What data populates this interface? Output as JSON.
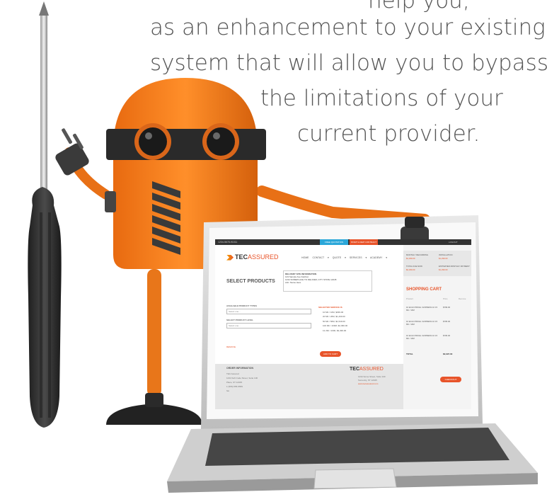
{
  "headline": [
    "help you,",
    "as an enhancement to your existing",
    "system that will allow you to bypass",
    "the limitations of your",
    "current provider."
  ],
  "colors": {
    "robot_orange": "#f07a1a",
    "screwdriver_handle": "#2d2d2d",
    "screen_accent": "#e8542a",
    "screen_blue": "#2ba7d9",
    "laptop_silver": "#d9d9d9"
  },
  "screen": {
    "topbar": {
      "phone": "1234-5678-91011",
      "quote_button": "FREE QUOTATION",
      "rep_button": "START A REP CONTRACT",
      "account": "LOGOUT"
    },
    "logo": {
      "part1": "TEC",
      "part2": "ASSURED"
    },
    "nav": "HOME  CONTACT ▾  QUOTE ▾  SERVICES ▾  ACADEMY ▾",
    "select_products": "SELECT PRODUCTS",
    "delivery": {
      "title": "DELIVERY SITE INFORMATION",
      "lines": [
        "123 Sample Ave Fashion",
        "1234 SOMEPLACE TO DELIVER, CITY STATE 12345",
        "Attn: Name Here"
      ]
    },
    "fields": [
      {
        "label": "AVAILABLE PRODUCT TYPES",
        "placeholder": "Select one..."
      },
      {
        "label": "SELECT PRODUCT LEVEL",
        "placeholder": "Select one..."
      }
    ],
    "remove_link": "REMOVE",
    "pricing": {
      "header": "SELECTED SERVICE IS",
      "rows": [
        "10 Mb / 10M, $299.00",
        "20 Mb / 20M, $1,299.00",
        "50 Mb / 50M, $1,549.00",
        "100 Mb / 100M, $2,399.00",
        "1G Mb / 1000, $3,499.00"
      ],
      "add_button": "ADD TO CART"
    },
    "footer": {
      "header": "ORDER INFORMATION",
      "lines": [
        "TEC Assured",
        "1234 Soft Code Street, Suite 100",
        "Place, ST 12345",
        "1 (555) 555-5555",
        "fax"
      ],
      "logo": {
        "part1": "TEC",
        "part2": "ASSURED"
      },
      "address": [
        "1234 Some Street, Suite 100",
        "Somecity, ST 12345",
        "www.tecassured.com"
      ]
    },
    "cart": {
      "summary": [
        {
          "label": "MONTHLY RECURRING",
          "value": "$1,299.00"
        },
        {
          "label": "INSTALLATION",
          "value": "$1,299.00"
        },
        {
          "label": "TOTAL DUE NOW",
          "value": "$2,299.00"
        },
        {
          "label": "ESTIMATED MONTHLY PAYMENT",
          "value": "$1,299.00"
        }
      ],
      "title": "SHOPPING CART",
      "columns": [
        "Product",
        "Price",
        "Remove"
      ],
      "items": [
        {
          "name": "10 ECLN PRICE / EXPRESS 10 15 Mb / 10M",
          "price": "$799.00"
        },
        {
          "name": "10 ECLN PRICE / EXPRESS 10 15 Mb / 10M",
          "price": "$795.00"
        },
        {
          "name": "10 ECLN PRICE / EXPRESS 10 15 Mb / 10M",
          "price": "$795.00"
        }
      ],
      "total_label": "TOTAL",
      "total_value": "$2,997.00",
      "checkout": "CHECKOUT"
    }
  }
}
